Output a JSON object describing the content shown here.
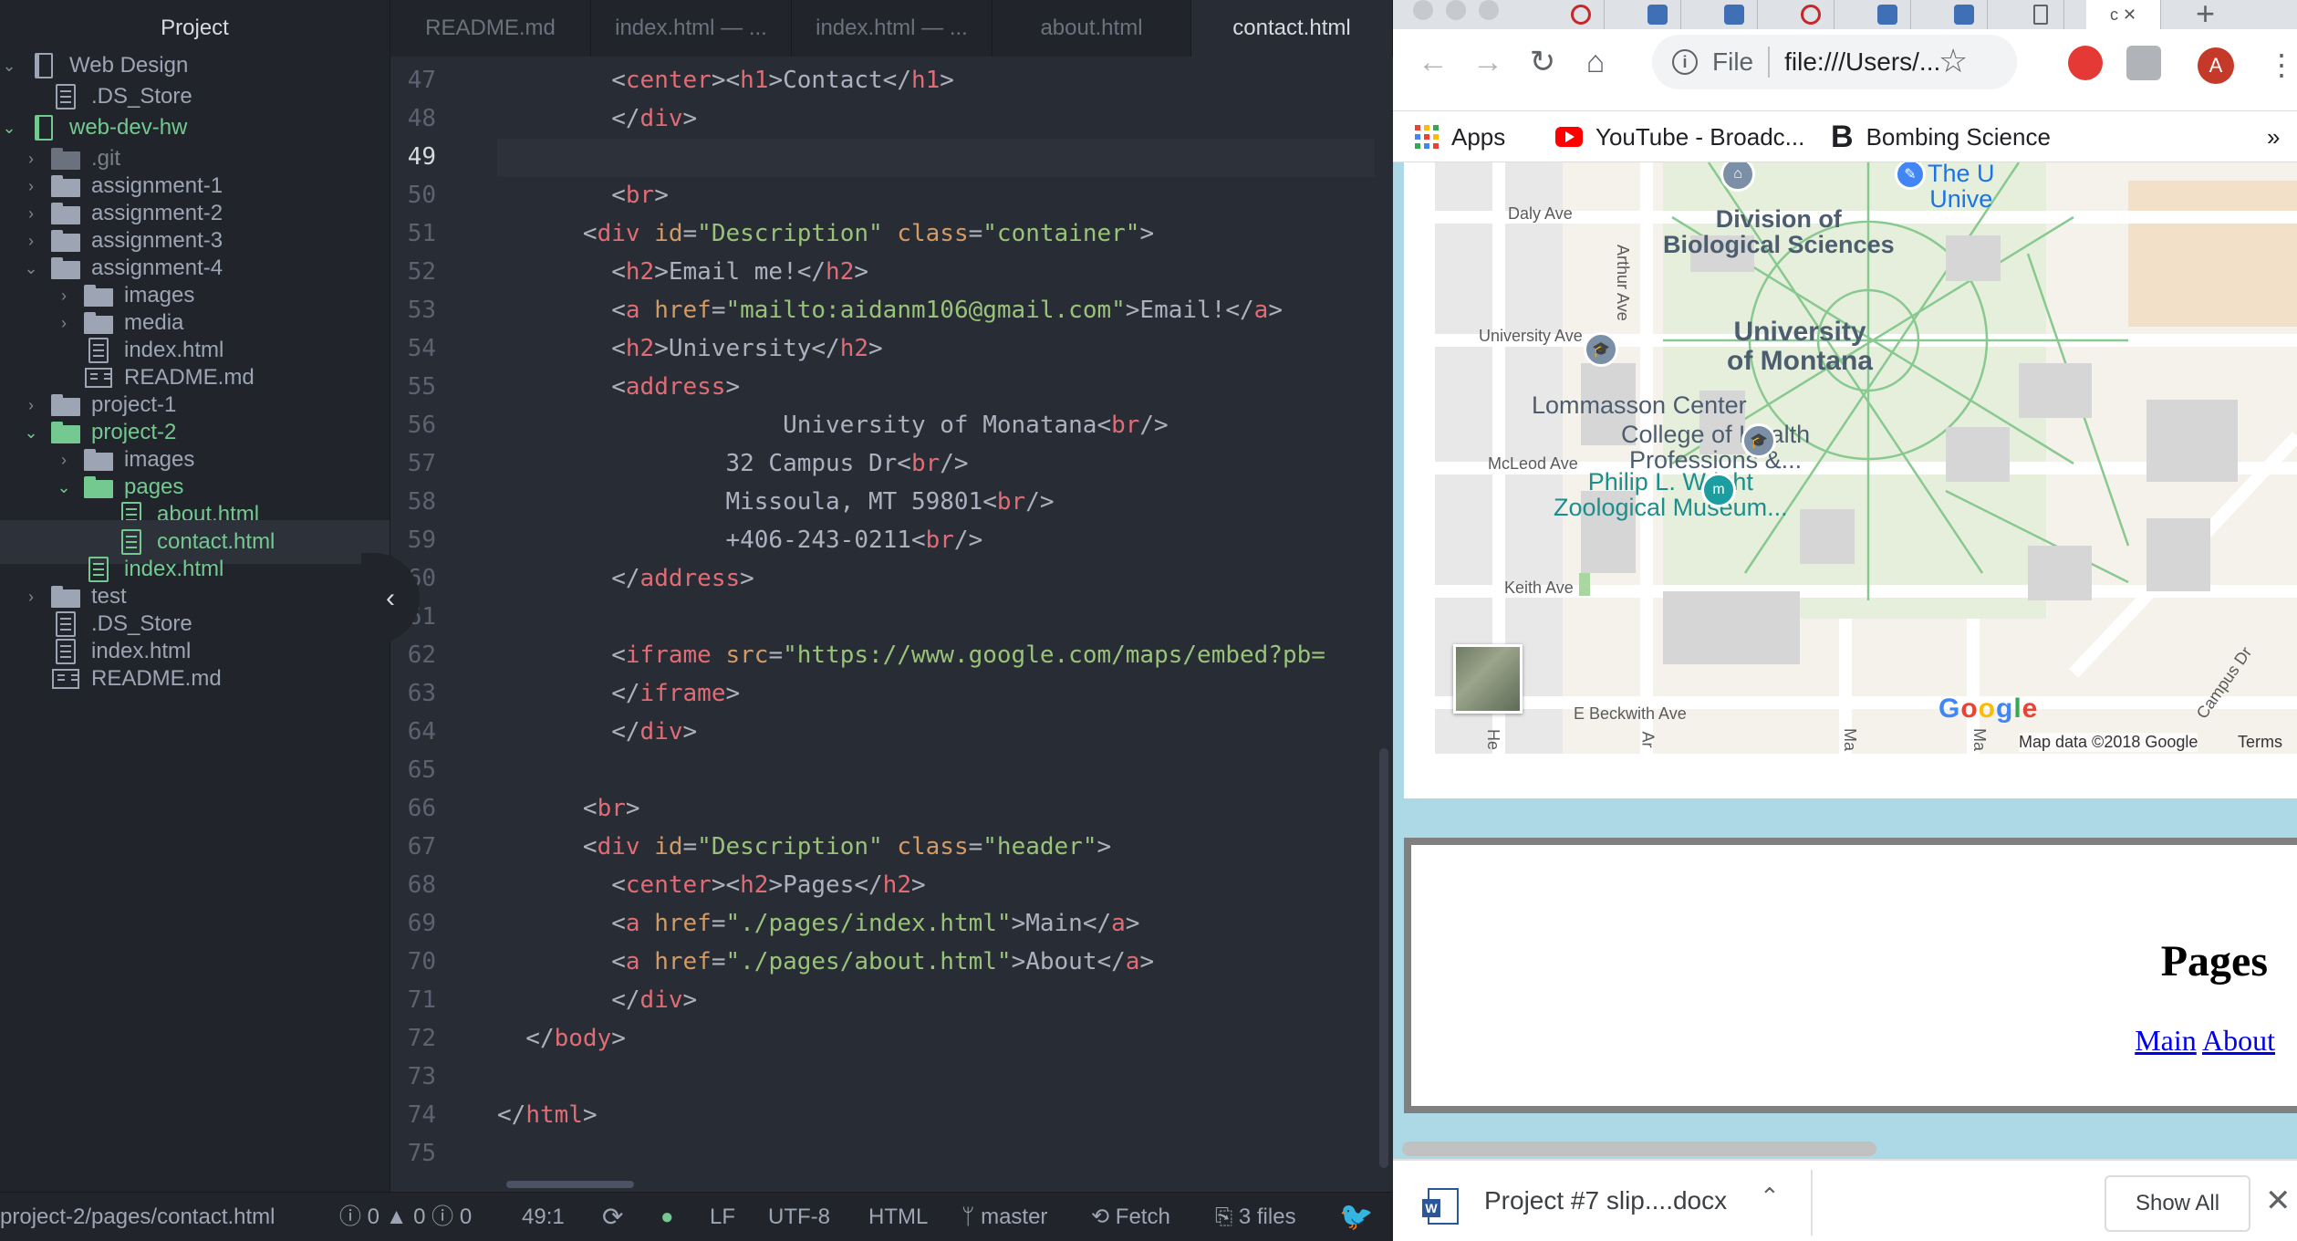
{
  "editor": {
    "tree": {
      "title": "Project",
      "items": [
        {
          "label": "Web Design",
          "type": "repo",
          "arrow": "⌄",
          "green": false
        },
        {
          "label": ".DS_Store",
          "type": "file"
        },
        {
          "label": "web-dev-hw",
          "type": "repo",
          "arrow": "⌄",
          "green": true
        },
        {
          "label": ".git",
          "type": "folder",
          "arrow": "›",
          "dim": true
        },
        {
          "label": "assignment-1",
          "type": "folder",
          "arrow": "›"
        },
        {
          "label": "assignment-2",
          "type": "folder",
          "arrow": "›"
        },
        {
          "label": "assignment-3",
          "type": "folder",
          "arrow": "›"
        },
        {
          "label": "assignment-4",
          "type": "folder",
          "arrow": "⌄"
        },
        {
          "label": "images",
          "type": "folder",
          "arrow": "›"
        },
        {
          "label": "media",
          "type": "folder",
          "arrow": "›"
        },
        {
          "label": "index.html",
          "type": "file"
        },
        {
          "label": "README.md",
          "type": "book"
        },
        {
          "label": "project-1",
          "type": "folder",
          "arrow": "›"
        },
        {
          "label": "project-2",
          "type": "folder",
          "arrow": "⌄",
          "green": true
        },
        {
          "label": "images",
          "type": "folder",
          "arrow": "›"
        },
        {
          "label": "pages",
          "type": "folder",
          "arrow": "⌄",
          "green": true
        },
        {
          "label": "about.html",
          "type": "file",
          "green": true
        },
        {
          "label": "contact.html",
          "type": "file",
          "green": true,
          "selected": true
        },
        {
          "label": "index.html",
          "type": "file",
          "green": true
        },
        {
          "label": "test",
          "type": "folder",
          "arrow": "›"
        },
        {
          "label": ".DS_Store",
          "type": "file"
        },
        {
          "label": "index.html",
          "type": "file"
        },
        {
          "label": "README.md",
          "type": "book"
        }
      ]
    },
    "tabs": [
      {
        "label": "README.md"
      },
      {
        "label": "index.html — ..."
      },
      {
        "label": "index.html — ..."
      },
      {
        "label": "about.html"
      },
      {
        "label": "contact.html",
        "active": true
      }
    ],
    "current_line": 49,
    "lines": [
      {
        "n": "47",
        "tokens": [
          [
            "pl",
            "        <"
          ],
          [
            "tg",
            "center"
          ],
          [
            "pl",
            "><"
          ],
          [
            "tg",
            "h1"
          ],
          [
            "pl",
            ">Contact</"
          ],
          [
            "tg",
            "h1"
          ],
          [
            "pl",
            ">"
          ]
        ]
      },
      {
        "n": "48",
        "tokens": [
          [
            "pl",
            "        </"
          ],
          [
            "tg",
            "div"
          ],
          [
            "pl",
            ">"
          ]
        ]
      },
      {
        "n": "49",
        "tokens": []
      },
      {
        "n": "50",
        "tokens": [
          [
            "pl",
            "        <"
          ],
          [
            "tg",
            "br"
          ],
          [
            "pl",
            ">"
          ]
        ]
      },
      {
        "n": "51",
        "tokens": [
          [
            "pl",
            "      <"
          ],
          [
            "tg",
            "div"
          ],
          [
            "pl",
            " "
          ],
          [
            "at",
            "id"
          ],
          [
            "pl",
            "="
          ],
          [
            "st",
            "\"Description\""
          ],
          [
            "pl",
            " "
          ],
          [
            "at",
            "class"
          ],
          [
            "pl",
            "="
          ],
          [
            "st",
            "\"container\""
          ],
          [
            "pl",
            ">"
          ]
        ]
      },
      {
        "n": "52",
        "tokens": [
          [
            "pl",
            "        <"
          ],
          [
            "tg",
            "h2"
          ],
          [
            "pl",
            ">Email me!</"
          ],
          [
            "tg",
            "h2"
          ],
          [
            "pl",
            ">"
          ]
        ]
      },
      {
        "n": "53",
        "tokens": [
          [
            "pl",
            "        <"
          ],
          [
            "tg",
            "a"
          ],
          [
            "pl",
            " "
          ],
          [
            "at",
            "href"
          ],
          [
            "pl",
            "="
          ],
          [
            "st",
            "\"mailto:aidanm106@gmail.com\""
          ],
          [
            "pl",
            ">Email!</"
          ],
          [
            "tg",
            "a"
          ],
          [
            "pl",
            ">"
          ]
        ]
      },
      {
        "n": "54",
        "tokens": [
          [
            "pl",
            "        <"
          ],
          [
            "tg",
            "h2"
          ],
          [
            "pl",
            ">University</"
          ],
          [
            "tg",
            "h2"
          ],
          [
            "pl",
            ">"
          ]
        ]
      },
      {
        "n": "55",
        "tokens": [
          [
            "pl",
            "        <"
          ],
          [
            "tg",
            "address"
          ],
          [
            "pl",
            ">"
          ]
        ]
      },
      {
        "n": "56",
        "tokens": [
          [
            "pl",
            "                    University of Monatana<"
          ],
          [
            "tg",
            "br"
          ],
          [
            "pl",
            "/>"
          ]
        ]
      },
      {
        "n": "57",
        "tokens": [
          [
            "pl",
            "                32 Campus Dr<"
          ],
          [
            "tg",
            "br"
          ],
          [
            "pl",
            "/>"
          ]
        ]
      },
      {
        "n": "58",
        "tokens": [
          [
            "pl",
            "                Missoula, MT 59801<"
          ],
          [
            "tg",
            "br"
          ],
          [
            "pl",
            "/>"
          ]
        ]
      },
      {
        "n": "59",
        "tokens": [
          [
            "pl",
            "                +406-243-0211<"
          ],
          [
            "tg",
            "br"
          ],
          [
            "pl",
            "/>"
          ]
        ]
      },
      {
        "n": "60",
        "tokens": [
          [
            "pl",
            "        </"
          ],
          [
            "tg",
            "address"
          ],
          [
            "pl",
            ">"
          ]
        ]
      },
      {
        "n": "61",
        "tokens": []
      },
      {
        "n": "62",
        "tokens": [
          [
            "pl",
            "        <"
          ],
          [
            "tg",
            "iframe"
          ],
          [
            "pl",
            " "
          ],
          [
            "at",
            "src"
          ],
          [
            "pl",
            "="
          ],
          [
            "st",
            "\"https://www.google.com/maps/embed?pb="
          ]
        ]
      },
      {
        "n": "63",
        "tokens": [
          [
            "pl",
            "        </"
          ],
          [
            "tg",
            "iframe"
          ],
          [
            "pl",
            ">"
          ]
        ]
      },
      {
        "n": "64",
        "tokens": [
          [
            "pl",
            "        </"
          ],
          [
            "tg",
            "div"
          ],
          [
            "pl",
            ">"
          ]
        ]
      },
      {
        "n": "65",
        "tokens": []
      },
      {
        "n": "66",
        "tokens": [
          [
            "pl",
            "      <"
          ],
          [
            "tg",
            "br"
          ],
          [
            "pl",
            ">"
          ]
        ]
      },
      {
        "n": "67",
        "tokens": [
          [
            "pl",
            "      <"
          ],
          [
            "tg",
            "div"
          ],
          [
            "pl",
            " "
          ],
          [
            "at",
            "id"
          ],
          [
            "pl",
            "="
          ],
          [
            "st",
            "\"Description\""
          ],
          [
            "pl",
            " "
          ],
          [
            "at",
            "class"
          ],
          [
            "pl",
            "="
          ],
          [
            "st",
            "\"header\""
          ],
          [
            "pl",
            ">"
          ]
        ]
      },
      {
        "n": "68",
        "tokens": [
          [
            "pl",
            "        <"
          ],
          [
            "tg",
            "center"
          ],
          [
            "pl",
            "><"
          ],
          [
            "tg",
            "h2"
          ],
          [
            "pl",
            ">Pages</"
          ],
          [
            "tg",
            "h2"
          ],
          [
            "pl",
            ">"
          ]
        ]
      },
      {
        "n": "69",
        "tokens": [
          [
            "pl",
            "        <"
          ],
          [
            "tg",
            "a"
          ],
          [
            "pl",
            " "
          ],
          [
            "at",
            "href"
          ],
          [
            "pl",
            "="
          ],
          [
            "st",
            "\"./pages/index.html\""
          ],
          [
            "pl",
            ">Main</"
          ],
          [
            "tg",
            "a"
          ],
          [
            "pl",
            ">"
          ]
        ]
      },
      {
        "n": "70",
        "tokens": [
          [
            "pl",
            "        <"
          ],
          [
            "tg",
            "a"
          ],
          [
            "pl",
            " "
          ],
          [
            "at",
            "href"
          ],
          [
            "pl",
            "="
          ],
          [
            "st",
            "\"./pages/about.html\""
          ],
          [
            "pl",
            ">About</"
          ],
          [
            "tg",
            "a"
          ],
          [
            "pl",
            ">"
          ]
        ]
      },
      {
        "n": "71",
        "tokens": [
          [
            "pl",
            "        </"
          ],
          [
            "tg",
            "div"
          ],
          [
            "pl",
            ">"
          ]
        ]
      },
      {
        "n": "72",
        "tokens": [
          [
            "pl",
            "  </"
          ],
          [
            "tg",
            "body"
          ],
          [
            "pl",
            ">"
          ]
        ]
      },
      {
        "n": "73",
        "tokens": []
      },
      {
        "n": "74",
        "tokens": [
          [
            "pl",
            "</"
          ],
          [
            "tg",
            "html"
          ],
          [
            "pl",
            ">"
          ]
        ]
      },
      {
        "n": "75",
        "tokens": []
      }
    ],
    "status": {
      "path": "project-2/pages/contact.html",
      "errors": "0",
      "warnings": "0",
      "infos": "0",
      "cursor": "49:1",
      "line_ending": "LF",
      "encoding": "UTF-8",
      "grammar": "HTML",
      "branch": "master",
      "fetch": "Fetch",
      "files": "3 files"
    }
  },
  "browser": {
    "active_tab_letter": "c",
    "omnibox": {
      "scheme": "File",
      "url": "file:///Users/..."
    },
    "profile_initial": "A",
    "bookmarks": [
      {
        "label": "Apps",
        "icon": "apps-grid-icon"
      },
      {
        "label": "YouTube - Broadc...",
        "icon": "youtube-icon"
      },
      {
        "label": "Bombing Science",
        "icon": "b-icon"
      }
    ],
    "bookmarks_overflow": "»",
    "map": {
      "streets": [
        "Daly Ave",
        "University Ave",
        "McLeod Ave",
        "Keith Ave",
        "E Beckwith Ave",
        "Arthur Ave",
        "Campus Dr",
        "He",
        "Ar",
        "Ma",
        "Ma"
      ],
      "places": [
        "Division of\nBiological Sciences",
        "University\nof Montana",
        "Lommasson Center",
        "College of Health\nProfessions &...",
        "Philip L. Wright\nZoological Museum...",
        "The U\nUnive"
      ],
      "logo": "Google",
      "attribution": "Map data ©2018 Google",
      "terms": "Terms"
    },
    "pages_section": {
      "heading": "Pages",
      "links": [
        "Main",
        "About"
      ]
    },
    "download": {
      "filename": "Project #7 slip....docx",
      "show_all": "Show All"
    }
  }
}
